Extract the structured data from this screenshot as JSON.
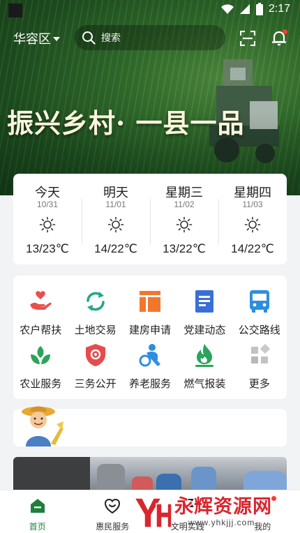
{
  "status_bar": {
    "time": "2:17"
  },
  "header": {
    "district": "华容区",
    "search_placeholder": "搜索",
    "slogan": "振兴乡村· 一县一品"
  },
  "weather": [
    {
      "day": "今天",
      "date": "10/31",
      "temp": "13/23℃",
      "icon": "sun-icon"
    },
    {
      "day": "明天",
      "date": "11/01",
      "temp": "14/22℃",
      "icon": "sun-icon"
    },
    {
      "day": "星期三",
      "date": "11/02",
      "temp": "13/22℃",
      "icon": "sun-icon"
    },
    {
      "day": "星期四",
      "date": "11/03",
      "temp": "14/22℃",
      "icon": "sun-icon"
    }
  ],
  "services": [
    {
      "label": "农户帮扶",
      "icon": "heart-hand-icon",
      "color": "#e8504f"
    },
    {
      "label": "土地交易",
      "icon": "exchange-icon",
      "color": "#21a98b"
    },
    {
      "label": "建房申请",
      "icon": "building-icon",
      "color": "#f2772d"
    },
    {
      "label": "党建动态",
      "icon": "document-icon",
      "color": "#3a6fd8"
    },
    {
      "label": "公交路线",
      "icon": "bus-icon",
      "color": "#2d8ee0"
    },
    {
      "label": "农业服务",
      "icon": "sprout-icon",
      "color": "#2aa55b"
    },
    {
      "label": "三务公开",
      "icon": "shield-icon",
      "color": "#e64c4c"
    },
    {
      "label": "养老服务",
      "icon": "elder-care-icon",
      "color": "#2d8ee0"
    },
    {
      "label": "燃气报装",
      "icon": "flame-icon",
      "color": "#2aa55b"
    },
    {
      "label": "更多",
      "icon": "more-grid-icon",
      "color": "#b9b9b9"
    }
  ],
  "bottom_nav": [
    {
      "label": "首页",
      "icon": "home-icon",
      "active": true
    },
    {
      "label": "惠民服务",
      "icon": "smile-heart-icon",
      "active": false
    },
    {
      "label": "文明实践",
      "icon": "flag-icon",
      "active": false
    },
    {
      "label": "我的",
      "icon": "user-icon",
      "active": false
    }
  ],
  "watermark": {
    "title": "永辉资源网",
    "url": "www.yhkjjj.com"
  },
  "colors": {
    "accent_green": "#1d7f3c",
    "badge_red": "#ff3b30"
  }
}
